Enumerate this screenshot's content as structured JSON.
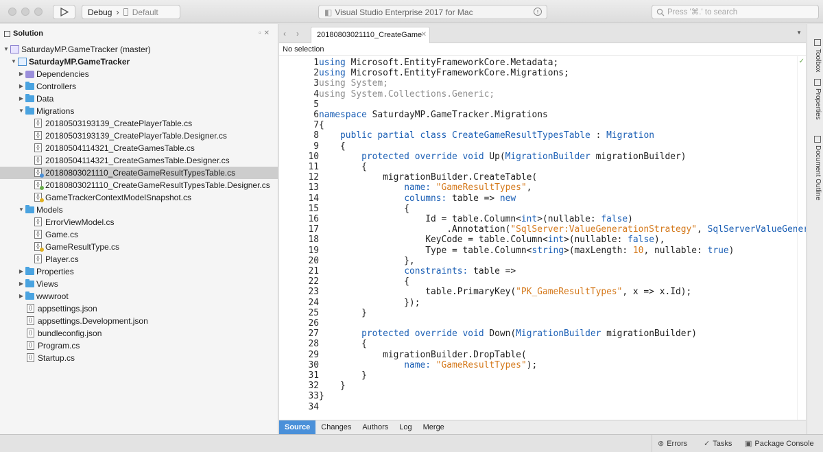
{
  "toolbar": {
    "configuration": "Debug",
    "separator": "›",
    "device": "Default",
    "status_text": "Visual Studio Enterprise 2017 for Mac",
    "search_placeholder": "Press '⌘.' to search"
  },
  "solution": {
    "title": "Solution",
    "items": [
      {
        "label": "SaturdayMP.GameTracker (master)",
        "type": "solution",
        "indent": 0,
        "arrow": "▼"
      },
      {
        "label": "SaturdayMP.GameTracker",
        "type": "project",
        "indent": 1,
        "arrow": "▼",
        "bold": true
      },
      {
        "label": "Dependencies",
        "type": "deps",
        "indent": 2,
        "arrow": "▶"
      },
      {
        "label": "Controllers",
        "type": "folder",
        "indent": 2,
        "arrow": "▶"
      },
      {
        "label": "Data",
        "type": "folder",
        "indent": 2,
        "arrow": "▶"
      },
      {
        "label": "Migrations",
        "type": "folder",
        "indent": 2,
        "arrow": "▼"
      },
      {
        "label": "20180503193139_CreatePlayerTable.cs",
        "type": "file",
        "indent": 3
      },
      {
        "label": "20180503193139_CreatePlayerTable.Designer.cs",
        "type": "file",
        "indent": 3
      },
      {
        "label": "20180504114321_CreateGamesTable.cs",
        "type": "file",
        "indent": 3
      },
      {
        "label": "20180504114321_CreateGamesTable.Designer.cs",
        "type": "file",
        "indent": 3
      },
      {
        "label": "20180803021110_CreateGameResultTypesTable.cs",
        "type": "file",
        "indent": 3,
        "selected": true,
        "badge": "#4a90d9"
      },
      {
        "label": "20180803021110_CreateGameResultTypesTable.Designer.cs",
        "type": "file",
        "indent": 3,
        "badge": "#6ab04c"
      },
      {
        "label": "GameTrackerContextModelSnapshot.cs",
        "type": "file",
        "indent": 3,
        "badge": "#e0b020"
      },
      {
        "label": "Models",
        "type": "folder",
        "indent": 2,
        "arrow": "▼"
      },
      {
        "label": "ErrorViewModel.cs",
        "type": "file",
        "indent": 3
      },
      {
        "label": "Game.cs",
        "type": "file",
        "indent": 3
      },
      {
        "label": "GameResultType.cs",
        "type": "file",
        "indent": 3,
        "badge": "#e0b020"
      },
      {
        "label": "Player.cs",
        "type": "file",
        "indent": 3
      },
      {
        "label": "Properties",
        "type": "folder",
        "indent": 2,
        "arrow": "▶"
      },
      {
        "label": "Views",
        "type": "folder",
        "indent": 2,
        "arrow": "▶"
      },
      {
        "label": "wwwroot",
        "type": "folder",
        "indent": 2,
        "arrow": "▶"
      },
      {
        "label": "appsettings.json",
        "type": "file",
        "indent": 2
      },
      {
        "label": "appsettings.Development.json",
        "type": "file",
        "indent": 2
      },
      {
        "label": "bundleconfig.json",
        "type": "file",
        "indent": 2
      },
      {
        "label": "Program.cs",
        "type": "file",
        "indent": 2
      },
      {
        "label": "Startup.cs",
        "type": "file",
        "indent": 2
      }
    ]
  },
  "editor": {
    "tab_label": "20180803021110_CreateGame",
    "path_bar": "No selection",
    "lines": [
      [
        [
          "kw",
          "using"
        ],
        [
          "t",
          " Microsoft.EntityFrameworkCore.Metadata;"
        ]
      ],
      [
        [
          "kw",
          "using"
        ],
        [
          "t",
          " Microsoft.EntityFrameworkCore.Migrations;"
        ]
      ],
      [
        [
          "gray",
          "using System;"
        ]
      ],
      [
        [
          "gray",
          "using System.Collections.Generic;"
        ]
      ],
      [],
      [
        [
          "kw",
          "namespace"
        ],
        [
          "t",
          " SaturdayMP.GameTracker.Migrations"
        ]
      ],
      [
        [
          "t",
          "{"
        ]
      ],
      [
        [
          "t",
          "    "
        ],
        [
          "kw",
          "public partial class"
        ],
        [
          "t",
          " "
        ],
        [
          "kw",
          "CreateGameResultTypesTable"
        ],
        [
          "t",
          " : "
        ],
        [
          "kw",
          "Migration"
        ]
      ],
      [
        [
          "t",
          "    {"
        ]
      ],
      [
        [
          "t",
          "        "
        ],
        [
          "kw",
          "protected override void"
        ],
        [
          "t",
          " Up("
        ],
        [
          "kw",
          "MigrationBuilder"
        ],
        [
          "t",
          " migrationBuilder)"
        ]
      ],
      [
        [
          "t",
          "        {"
        ]
      ],
      [
        [
          "t",
          "            migrationBuilder.CreateTable("
        ]
      ],
      [
        [
          "t",
          "                "
        ],
        [
          "kw",
          "name:"
        ],
        [
          "t",
          " "
        ],
        [
          "str",
          "\"GameResultTypes\""
        ],
        [
          "t",
          ","
        ]
      ],
      [
        [
          "t",
          "                "
        ],
        [
          "kw",
          "columns:"
        ],
        [
          "t",
          " table => "
        ],
        [
          "kw",
          "new"
        ]
      ],
      [
        [
          "t",
          "                {"
        ]
      ],
      [
        [
          "t",
          "                    Id = table.Column<"
        ],
        [
          "kw",
          "int"
        ],
        [
          "t",
          ">(nullable: "
        ],
        [
          "kw",
          "false"
        ],
        [
          "t",
          ")"
        ]
      ],
      [
        [
          "t",
          "                        .Annotation("
        ],
        [
          "str",
          "\"SqlServer:ValueGenerationStrategy\""
        ],
        [
          "t",
          ", "
        ],
        [
          "kw",
          "SqlServerValueGener"
        ]
      ],
      [
        [
          "t",
          "                    KeyCode = table.Column<"
        ],
        [
          "kw",
          "int"
        ],
        [
          "t",
          ">(nullable: "
        ],
        [
          "kw",
          "false"
        ],
        [
          "t",
          "),"
        ]
      ],
      [
        [
          "t",
          "                    Type = table.Column<"
        ],
        [
          "kw",
          "string"
        ],
        [
          "t",
          ">(maxLength: "
        ],
        [
          "str",
          "10"
        ],
        [
          "t",
          ", nullable: "
        ],
        [
          "kw",
          "true"
        ],
        [
          "t",
          ")"
        ]
      ],
      [
        [
          "t",
          "                },"
        ]
      ],
      [
        [
          "t",
          "                "
        ],
        [
          "kw",
          "constraints:"
        ],
        [
          "t",
          " table =>"
        ]
      ],
      [
        [
          "t",
          "                {"
        ]
      ],
      [
        [
          "t",
          "                    table.PrimaryKey("
        ],
        [
          "str",
          "\"PK_GameResultTypes\""
        ],
        [
          "t",
          ", x => x.Id);"
        ]
      ],
      [
        [
          "t",
          "                });"
        ]
      ],
      [
        [
          "t",
          "        }"
        ]
      ],
      [],
      [
        [
          "t",
          "        "
        ],
        [
          "kw",
          "protected override void"
        ],
        [
          "t",
          " Down("
        ],
        [
          "kw",
          "MigrationBuilder"
        ],
        [
          "t",
          " migrationBuilder)"
        ]
      ],
      [
        [
          "t",
          "        {"
        ]
      ],
      [
        [
          "t",
          "            migrationBuilder.DropTable("
        ]
      ],
      [
        [
          "t",
          "                "
        ],
        [
          "kw",
          "name:"
        ],
        [
          "t",
          " "
        ],
        [
          "str",
          "\"GameResultTypes\""
        ],
        [
          "t",
          ");"
        ]
      ],
      [
        [
          "t",
          "        }"
        ]
      ],
      [
        [
          "t",
          "    }"
        ]
      ],
      [
        [
          "t",
          "}"
        ]
      ],
      []
    ]
  },
  "bottom_tabs": [
    "Source",
    "Changes",
    "Authors",
    "Log",
    "Merge"
  ],
  "right_dock": [
    "Toolbox",
    "Properties",
    "Document Outline"
  ],
  "statusbar": {
    "errors": "Errors",
    "tasks": "Tasks",
    "package_console": "Package Console"
  }
}
